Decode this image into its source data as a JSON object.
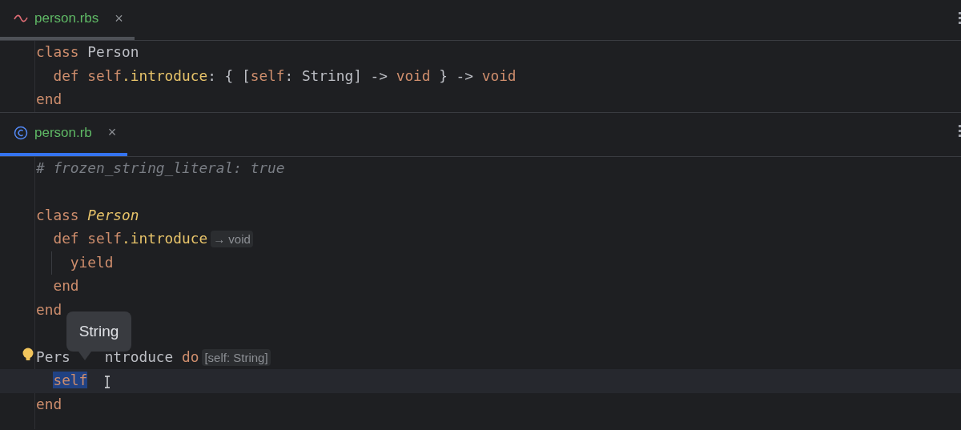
{
  "panes": [
    {
      "tab": {
        "name": "person.rbs",
        "close": "×",
        "selected": false
      },
      "lines": [
        {
          "kind": "code",
          "segments": [
            {
              "kind": "code",
              "tokens": [
                {
                  "t": "class",
                  "kind": "keyword"
                },
                {
                  "t": " Person",
                  "kind": "plain"
                }
              ]
            }
          ]
        },
        {
          "kind": "code",
          "segments": [
            {
              "kind": "code",
              "tokens": [
                {
                  "t": "  def",
                  "kind": "keyword"
                },
                {
                  "t": " self",
                  "kind": "keyword"
                },
                {
                  "t": ".introduce",
                  "kind": "method"
                },
                {
                  "t": ": { [",
                  "kind": "plain"
                },
                {
                  "t": "self",
                  "kind": "keyword"
                },
                {
                  "t": ": String] -> ",
                  "kind": "plain"
                },
                {
                  "t": "void",
                  "kind": "keyword"
                },
                {
                  "t": " } -> ",
                  "kind": "plain"
                },
                {
                  "t": "void",
                  "kind": "keyword"
                }
              ]
            }
          ]
        },
        {
          "kind": "code",
          "segments": [
            {
              "kind": "code",
              "tokens": [
                {
                  "t": "end",
                  "kind": "keyword"
                }
              ]
            }
          ]
        }
      ]
    },
    {
      "tab": {
        "name": "person.rb",
        "close": "×",
        "selected": true
      },
      "lines": [
        {
          "kind": "code",
          "segments": [
            {
              "kind": "code",
              "tokens": [
                {
                  "t": "# frozen_string_literal: true",
                  "kind": "comment"
                }
              ]
            }
          ]
        },
        {
          "kind": "blank"
        },
        {
          "kind": "code",
          "segments": [
            {
              "kind": "code",
              "tokens": [
                {
                  "t": "class",
                  "kind": "keyword"
                },
                {
                  "t": " Person",
                  "kind": "constant"
                }
              ]
            }
          ]
        },
        {
          "kind": "code",
          "segments": [
            {
              "kind": "code",
              "tokens": [
                {
                  "t": "  def",
                  "kind": "keyword"
                },
                {
                  "t": " self",
                  "kind": "keyword"
                },
                {
                  "t": ".introduce",
                  "kind": "method"
                }
              ]
            },
            {
              "kind": "hint",
              "text": "→ void"
            }
          ]
        },
        {
          "kind": "code",
          "guide": true,
          "segments": [
            {
              "kind": "code",
              "tokens": [
                {
                  "t": "    yield",
                  "kind": "keyword"
                }
              ]
            }
          ]
        },
        {
          "kind": "code",
          "segments": [
            {
              "kind": "code",
              "tokens": [
                {
                  "t": "  end",
                  "kind": "keyword"
                }
              ]
            }
          ]
        },
        {
          "kind": "code",
          "segments": [
            {
              "kind": "code",
              "tokens": [
                {
                  "t": "end",
                  "kind": "keyword"
                }
              ]
            }
          ]
        },
        {
          "kind": "blank"
        },
        {
          "kind": "code",
          "bulb": true,
          "segments": [
            {
              "kind": "code",
              "tokens": [
                {
                  "t": "Pers",
                  "kind": "plain"
                }
              ]
            },
            {
              "kind": "covered"
            },
            {
              "kind": "code",
              "tokens": [
                {
                  "t": "ntroduce",
                  "kind": "plain"
                },
                {
                  "t": " do",
                  "kind": "keyword"
                }
              ]
            },
            {
              "kind": "hint",
              "text": "[self: String]"
            }
          ]
        },
        {
          "kind": "code",
          "current": true,
          "cursor": true,
          "segments": [
            {
              "kind": "code",
              "tokens": [
                {
                  "t": "  self",
                  "kind": "selected"
                }
              ]
            }
          ]
        },
        {
          "kind": "code",
          "segments": [
            {
              "kind": "code",
              "tokens": [
                {
                  "t": "end",
                  "kind": "keyword"
                }
              ]
            }
          ]
        }
      ]
    }
  ],
  "tooltip": {
    "text": "String"
  }
}
